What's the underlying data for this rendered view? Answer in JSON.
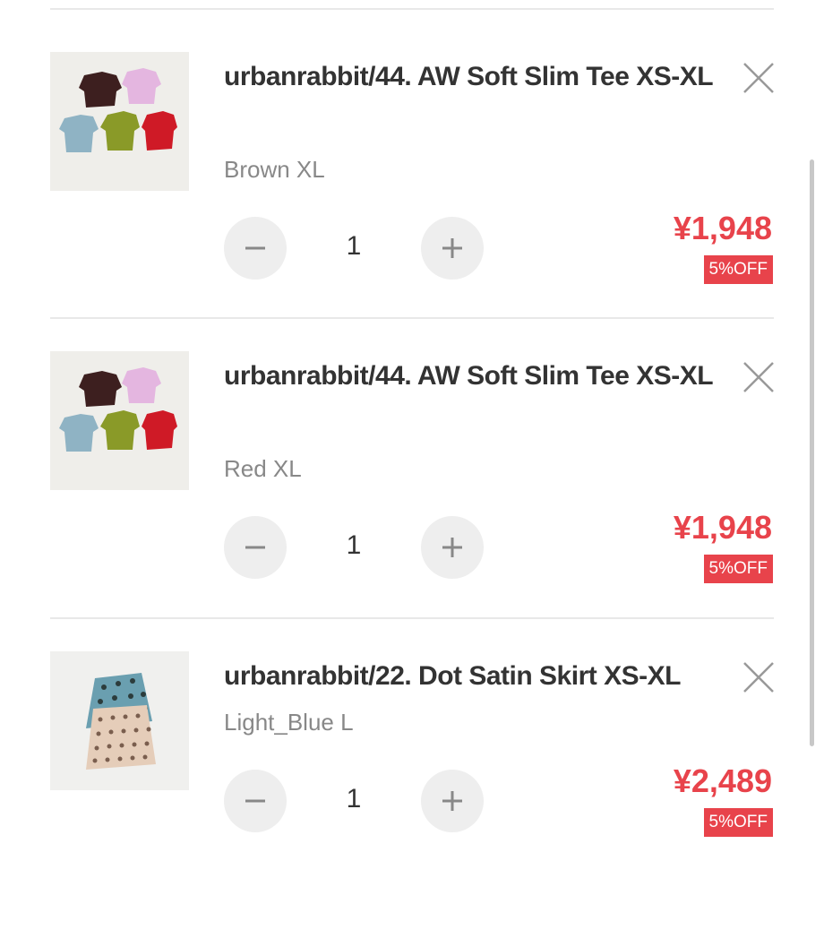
{
  "cart": {
    "items": [
      {
        "title": "urbanrabbit/44. AW Soft Slim Tee XS-XL",
        "variant": "Brown XL",
        "quantity": "1",
        "price": "¥1,948",
        "discount": "5%OFF",
        "image_icon": "tshirt-set-photo"
      },
      {
        "title": "urbanrabbit/44. AW Soft Slim Tee XS-XL",
        "variant": "Red XL",
        "quantity": "1",
        "price": "¥1,948",
        "discount": "5%OFF",
        "image_icon": "tshirt-set-photo"
      },
      {
        "title": "urbanrabbit/22. Dot Satin Skirt XS-XL",
        "variant": "Light_Blue L",
        "quantity": "1",
        "price": "¥2,489",
        "discount": "5%OFF",
        "image_icon": "dot-skirt-photo"
      }
    ]
  },
  "icons": {
    "remove": "close-icon",
    "decrease": "minus-icon",
    "increase": "plus-icon"
  },
  "colors": {
    "price": "#e8434b",
    "badge_bg": "#e8434b",
    "variant_text": "#888888",
    "qty_button_bg": "#eeeeee"
  }
}
